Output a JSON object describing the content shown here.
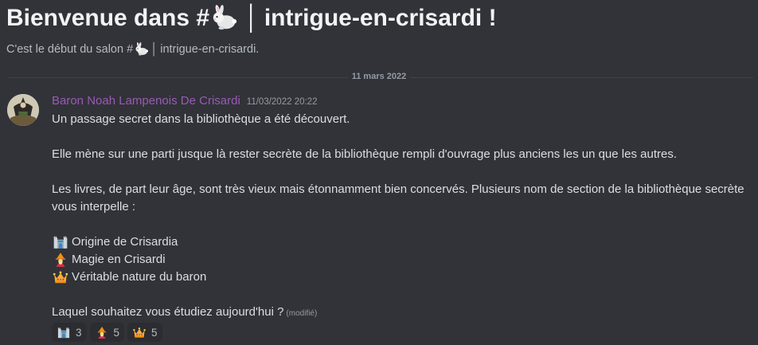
{
  "header": {
    "welcome_prefix": "Bienvenue dans #",
    "welcome_channel": "intrigue-en-crisardi !",
    "separator": "│",
    "subtitle_prefix": "C'est le début du salon #",
    "subtitle_channel": "intrigue-en-crisardi."
  },
  "date_divider": "11 mars 2022",
  "message": {
    "author": "Baron Noah Lampenois De Crisardi",
    "author_color": "#9b59b6",
    "timestamp": "11/03/2022 20:22",
    "lines": {
      "l1": "Un passage secret dans la bibliothèque a été découvert.",
      "l2": "Elle mène sur une parti jusque là rester secrète de la bibliothèque rempli d'ouvrage plus anciens les un que les autres.",
      "l3": "Les livres, de part leur âge, sont très vieux mais étonnamment bien concervés. Plusieurs nom de section de la bibliothèque secrète",
      "l4": "vous interpelle :",
      "opt1": "Origine de Crisardia",
      "opt2": "Magie en Crisardi",
      "opt3": "Véritable nature du baron",
      "question": "Laquel souhaitez vous étudiez aujourd'hui ?",
      "edited": "(modifié)"
    },
    "option_icons": [
      "castle-icon",
      "wizard-icon",
      "crown-icon"
    ]
  },
  "reactions": [
    {
      "icon": "castle-icon",
      "count": "3"
    },
    {
      "icon": "wizard-icon",
      "count": "5"
    },
    {
      "icon": "crown-icon",
      "count": "5"
    }
  ],
  "colors": {
    "background": "#313338",
    "text": "#dbdee1",
    "muted": "#949ba4"
  }
}
